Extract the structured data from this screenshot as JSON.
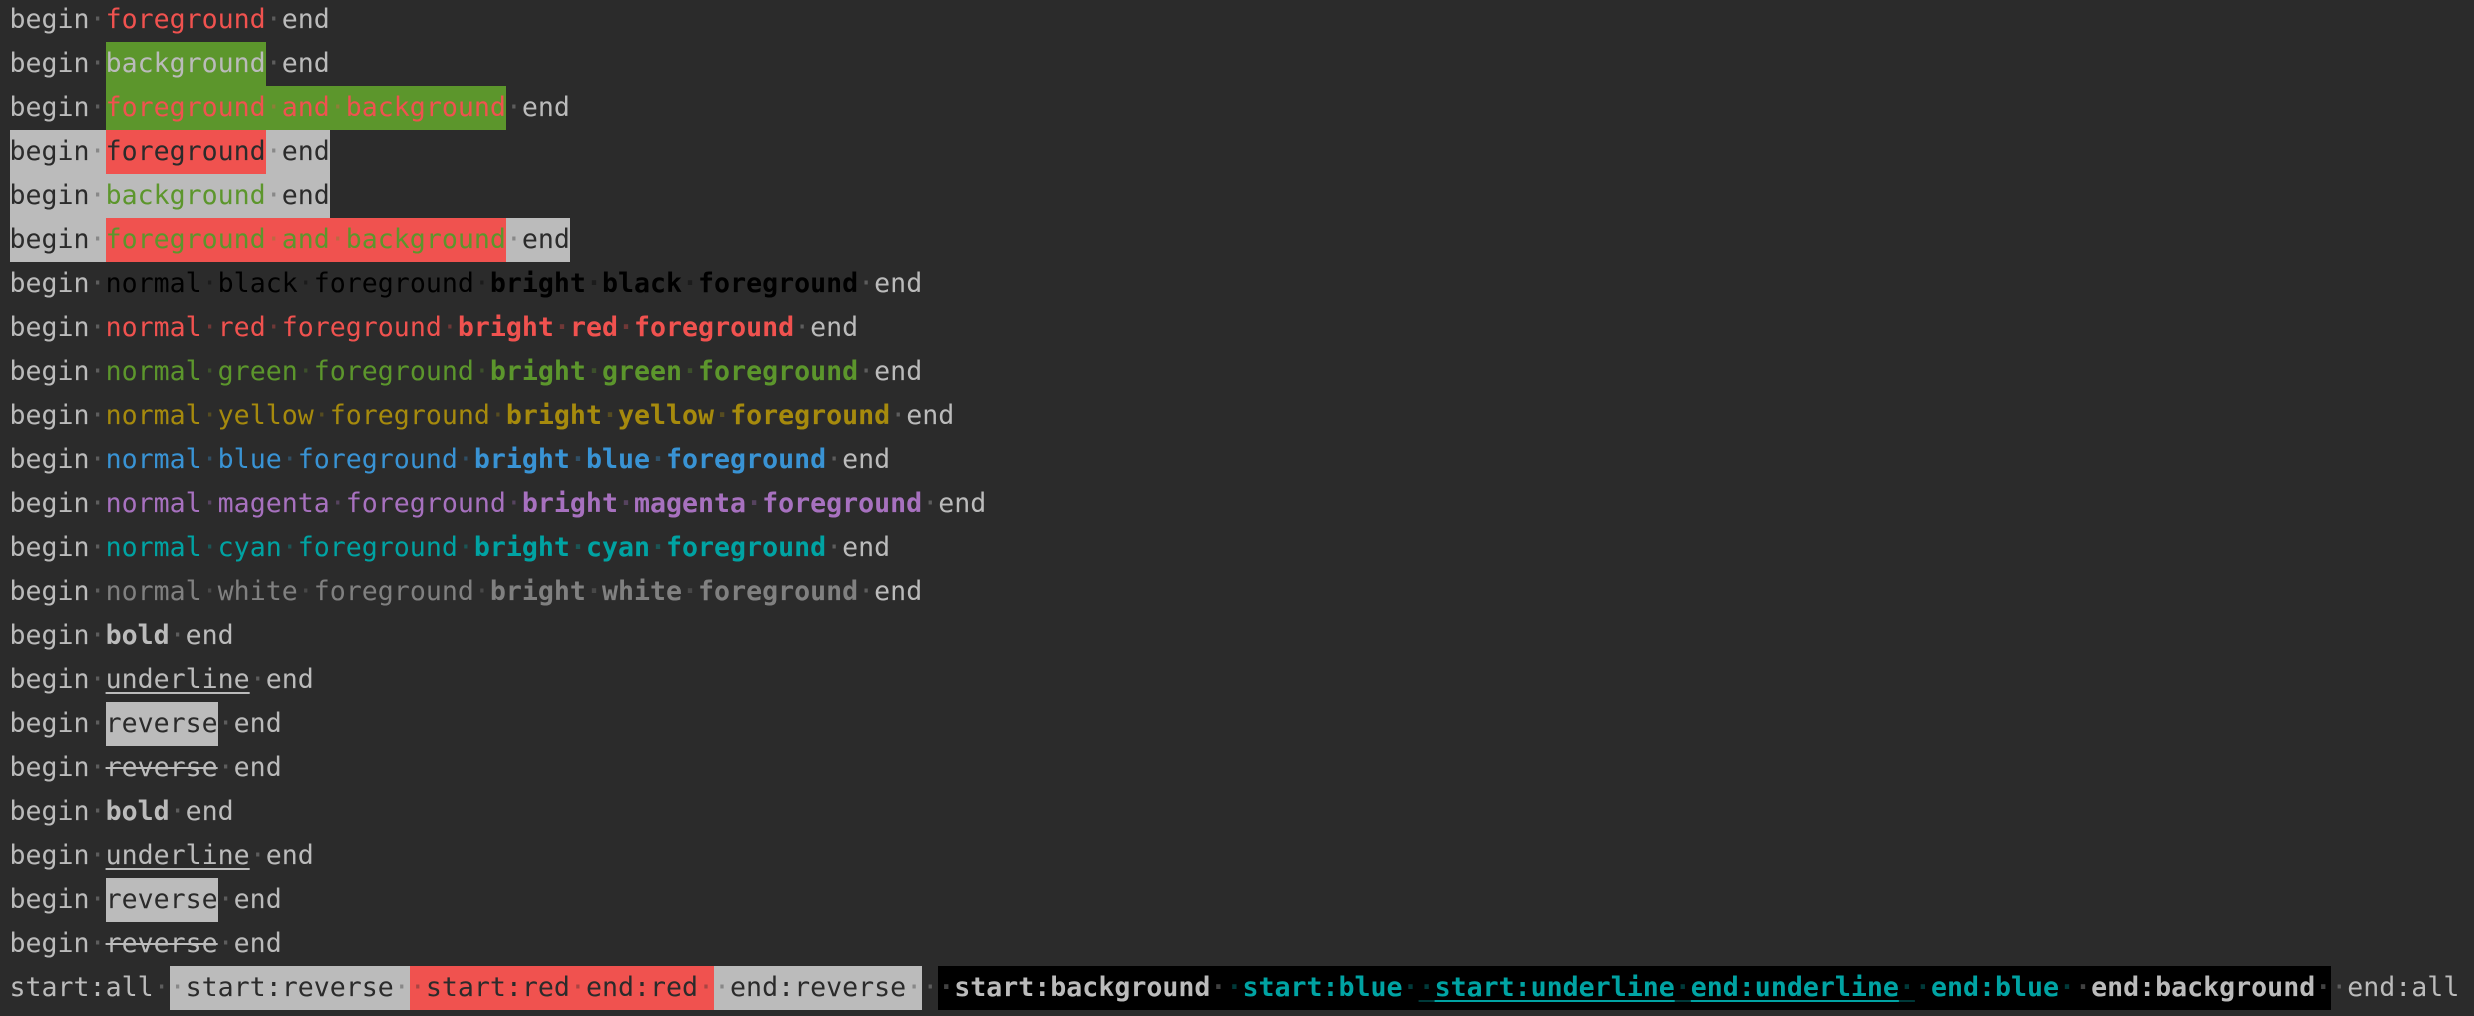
{
  "palette": {
    "background": "#2b2b2b",
    "default": "#bbbbbb",
    "dark": "#2b2b2b",
    "black": "#000000",
    "red": "#f0524f",
    "green": "#5c962c",
    "yellow": "#a68a0d",
    "blue": "#3993d4",
    "magenta": "#a771bf",
    "cyan": "#00a3a3",
    "white": "#808080",
    "gray": "#bbbbbb"
  },
  "lines": [
    [
      {
        "t": "begin "
      },
      {
        "t": "foreground",
        "fg": "red"
      },
      {
        "t": " end"
      }
    ],
    [
      {
        "t": "begin "
      },
      {
        "t": "background",
        "bg": "green"
      },
      {
        "t": " end"
      }
    ],
    [
      {
        "t": "begin "
      },
      {
        "t": "foreground and background",
        "fg": "red",
        "bg": "green"
      },
      {
        "t": " end"
      }
    ],
    [
      {
        "t": "begin ",
        "fg": "dark",
        "bg": "gray"
      },
      {
        "t": "foreground",
        "fg": "dark",
        "bg": "red"
      },
      {
        "t": " end",
        "fg": "dark",
        "bg": "gray"
      }
    ],
    [
      {
        "t": "begin ",
        "fg": "dark",
        "bg": "gray"
      },
      {
        "t": "background",
        "fg": "green",
        "bg": "gray"
      },
      {
        "t": " end",
        "fg": "dark",
        "bg": "gray"
      }
    ],
    [
      {
        "t": "begin ",
        "fg": "dark",
        "bg": "gray"
      },
      {
        "t": "foreground and background",
        "fg": "green",
        "bg": "red"
      },
      {
        "t": " end",
        "fg": "dark",
        "bg": "gray"
      }
    ],
    [
      {
        "t": "begin "
      },
      {
        "t": "normal black foreground ",
        "fg": "black"
      },
      {
        "t": "bright black foreground",
        "fg": "black",
        "bold": true
      },
      {
        "t": " end"
      }
    ],
    [
      {
        "t": "begin "
      },
      {
        "t": "normal red foreground ",
        "fg": "red"
      },
      {
        "t": "bright red foreground",
        "fg": "red",
        "bold": true
      },
      {
        "t": " end"
      }
    ],
    [
      {
        "t": "begin "
      },
      {
        "t": "normal green foreground ",
        "fg": "green"
      },
      {
        "t": "bright green foreground",
        "fg": "green",
        "bold": true
      },
      {
        "t": " end"
      }
    ],
    [
      {
        "t": "begin "
      },
      {
        "t": "normal yellow foreground ",
        "fg": "yellow"
      },
      {
        "t": "bright yellow foreground",
        "fg": "yellow",
        "bold": true
      },
      {
        "t": " end"
      }
    ],
    [
      {
        "t": "begin "
      },
      {
        "t": "normal blue foreground ",
        "fg": "blue"
      },
      {
        "t": "bright blue foreground",
        "fg": "blue",
        "bold": true
      },
      {
        "t": " end"
      }
    ],
    [
      {
        "t": "begin "
      },
      {
        "t": "normal magenta foreground ",
        "fg": "magenta"
      },
      {
        "t": "bright magenta foreground",
        "fg": "magenta",
        "bold": true
      },
      {
        "t": " end"
      }
    ],
    [
      {
        "t": "begin "
      },
      {
        "t": "normal cyan foreground ",
        "fg": "cyan"
      },
      {
        "t": "bright cyan foreground",
        "fg": "cyan",
        "bold": true
      },
      {
        "t": " end"
      }
    ],
    [
      {
        "t": "begin "
      },
      {
        "t": "normal white foreground ",
        "fg": "white"
      },
      {
        "t": "bright white foreground",
        "fg": "white",
        "bold": true
      },
      {
        "t": " end"
      }
    ],
    [
      {
        "t": "begin "
      },
      {
        "t": "bold",
        "bold": true
      },
      {
        "t": " end"
      }
    ],
    [
      {
        "t": "begin "
      },
      {
        "t": "underline",
        "underline": true
      },
      {
        "t": " end"
      }
    ],
    [
      {
        "t": "begin "
      },
      {
        "t": "reverse",
        "fg": "dark",
        "bg": "gray"
      },
      {
        "t": " end"
      }
    ],
    [
      {
        "t": "begin "
      },
      {
        "t": "reverse",
        "strike": true
      },
      {
        "t": " end"
      }
    ],
    [
      {
        "t": "begin "
      },
      {
        "t": "bold",
        "bold": true
      },
      {
        "t": " end"
      }
    ],
    [
      {
        "t": "begin "
      },
      {
        "t": "underline",
        "underline": true
      },
      {
        "t": " end"
      }
    ],
    [
      {
        "t": "begin "
      },
      {
        "t": "reverse",
        "fg": "dark",
        "bg": "gray"
      },
      {
        "t": " end"
      }
    ],
    [
      {
        "t": "begin "
      },
      {
        "t": "reverse",
        "strike": true
      },
      {
        "t": " end"
      }
    ],
    [
      {
        "t": "start:all "
      },
      {
        "t": " start:reverse ",
        "fg": "dark",
        "bg": "gray"
      },
      {
        "t": " start:red end:red ",
        "fg": "dark",
        "bg": "red"
      },
      {
        "t": " end:reverse ",
        "fg": "dark",
        "bg": "gray"
      },
      {
        "t": " "
      },
      {
        "t": " start:background ",
        "bg": "black",
        "bold": true
      },
      {
        "t": " start:blue ",
        "fg": "cyan",
        "bg": "black",
        "bold": true
      },
      {
        "t": " start:underline end:underline ",
        "fg": "cyan",
        "bg": "black",
        "bold": true,
        "underline": true
      },
      {
        "t": " end:blue ",
        "fg": "cyan",
        "bg": "black",
        "bold": true
      },
      {
        "t": " end:background ",
        "bg": "black",
        "bold": true
      },
      {
        "t": " end:all"
      }
    ]
  ]
}
